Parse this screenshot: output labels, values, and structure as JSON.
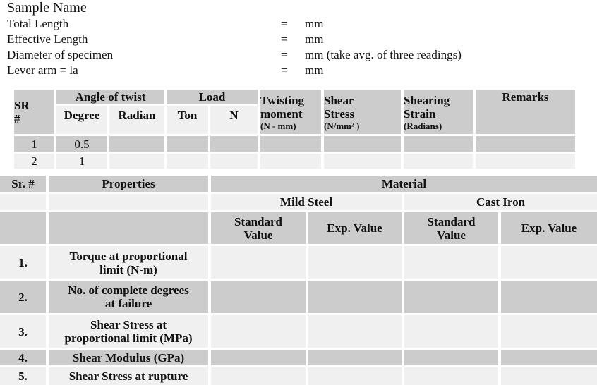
{
  "header": {
    "sample_name": "Sample Name",
    "fields": [
      {
        "label": "Total Length",
        "eq": "=",
        "unit": "mm"
      },
      {
        "label": "Effective Length",
        "eq": "=",
        "unit": "mm"
      },
      {
        "label": "Diameter of specimen",
        "eq": "=",
        "unit": "mm (take avg. of three readings)"
      },
      {
        "label": "Lever arm = la",
        "eq": "=",
        "unit": "mm"
      }
    ]
  },
  "table1": {
    "headers": {
      "sr": [
        "SR",
        "#"
      ],
      "angle_of_twist": "Angle of twist",
      "degree": "Degree",
      "radian": "Radian",
      "load": "Load",
      "ton": "Ton",
      "n": "N",
      "twisting_moment": [
        "Twisting",
        "moment"
      ],
      "twisting_moment_unit": "(N - mm)",
      "shear_stress": [
        "Shear",
        "Stress"
      ],
      "shear_stress_unit": "(N/mm² )",
      "shearing_strain": [
        "Shearing",
        "Strain"
      ],
      "shearing_strain_unit": "(Radians)",
      "remarks": "Remarks"
    },
    "rows": [
      {
        "sr": "1",
        "degree": "0.5",
        "radian": "",
        "ton": "",
        "n": "",
        "twisting_moment": "",
        "shear_stress": "",
        "shearing_strain": "",
        "remarks": ""
      },
      {
        "sr": "2",
        "degree": "1",
        "radian": "",
        "ton": "",
        "n": "",
        "twisting_moment": "",
        "shear_stress": "",
        "shearing_strain": "",
        "remarks": ""
      }
    ]
  },
  "table2": {
    "headers": {
      "sr": "Sr. #",
      "properties": "Properties",
      "material": "Material",
      "mild_steel": "Mild Steel",
      "cast_iron": "Cast Iron",
      "standard_value": [
        "Standard",
        "Value"
      ],
      "exp_value": "Exp. Value"
    },
    "rows": [
      {
        "sr": "1.",
        "property": [
          "Torque at proportional",
          "limit (N-m)"
        ],
        "ms_std": "",
        "ms_exp": "",
        "ci_std": "",
        "ci_exp": ""
      },
      {
        "sr": "2.",
        "property": [
          "No. of complete degrees",
          "at failure"
        ],
        "ms_std": "",
        "ms_exp": "",
        "ci_std": "",
        "ci_exp": ""
      },
      {
        "sr": "3.",
        "property": [
          "Shear Stress at",
          "proportional limit (MPa)"
        ],
        "ms_std": "",
        "ms_exp": "",
        "ci_std": "",
        "ci_exp": ""
      },
      {
        "sr": "4.",
        "property": [
          "Shear Modulus (GPa)"
        ],
        "ms_std": "",
        "ms_exp": "",
        "ci_std": "",
        "ci_exp": ""
      },
      {
        "sr": "5.",
        "property": [
          "Shear Stress at rupture"
        ],
        "ms_std": "",
        "ms_exp": "",
        "ci_std": "",
        "ci_exp": ""
      }
    ]
  },
  "colors": {
    "dark_cell": "#cccccc",
    "light_cell": "#f0f0f0"
  }
}
